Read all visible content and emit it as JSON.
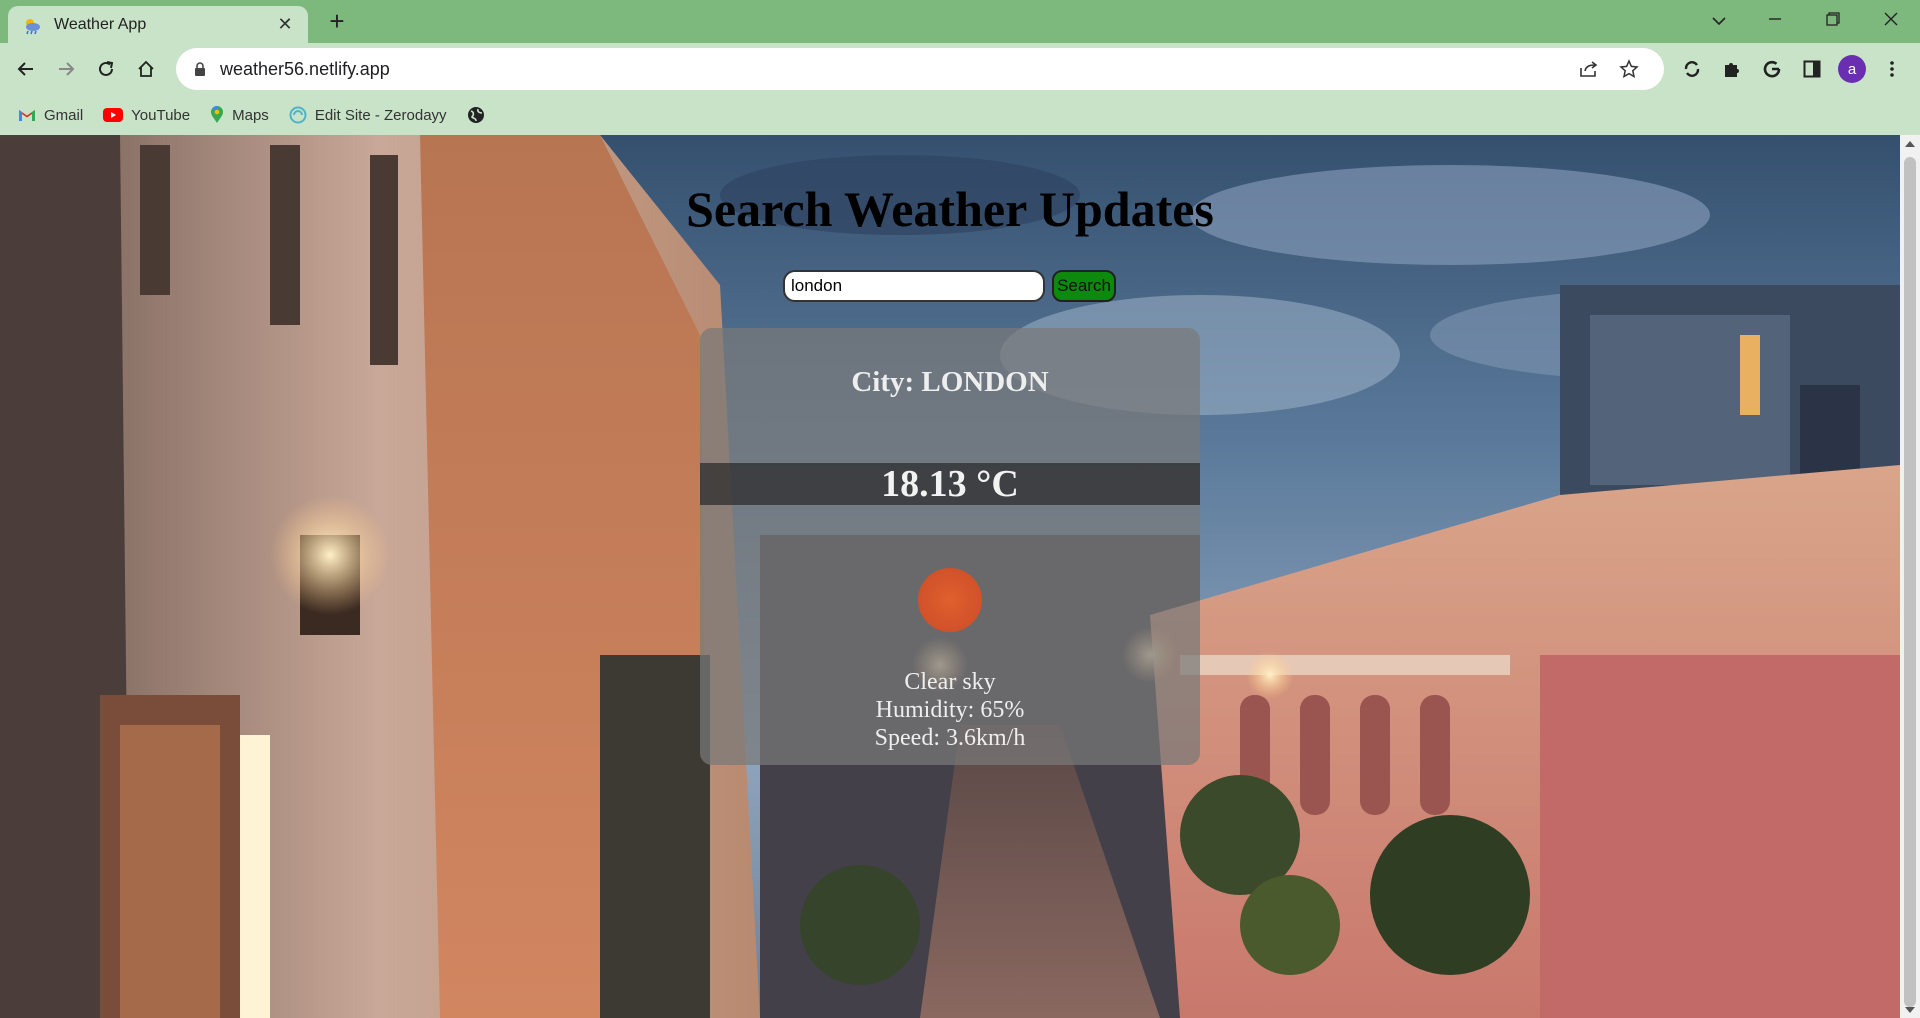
{
  "browser": {
    "tab_title": "Weather App",
    "url": "weather56.netlify.app",
    "avatar_letter": "a",
    "bookmarks": [
      {
        "label": "Gmail",
        "icon": "gmail-icon"
      },
      {
        "label": "YouTube",
        "icon": "youtube-icon"
      },
      {
        "label": "Maps",
        "icon": "maps-icon"
      },
      {
        "label": "Edit Site - Zerodayy",
        "icon": "site-icon"
      },
      {
        "label": "",
        "icon": "globe-icon"
      }
    ]
  },
  "page": {
    "title": "Search Weather Updates",
    "search_value": "london",
    "search_button": "Search",
    "city_label": "City: LONDON",
    "temperature": "18.13 °C",
    "condition": "Clear sky",
    "humidity": "Humidity: 65%",
    "speed": "Speed: 3.6km/h"
  },
  "colors": {
    "tab_strip": "#7db87d",
    "toolbar": "#c8e3c8",
    "search_button": "#0d8a0d",
    "weather_icon": "#d1512a"
  }
}
